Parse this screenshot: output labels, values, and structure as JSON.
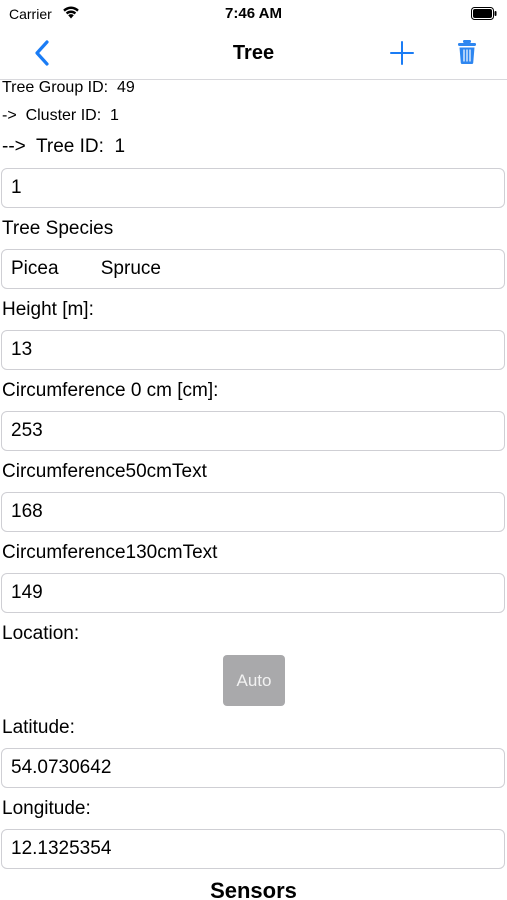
{
  "status_bar": {
    "carrier": "Carrier",
    "time": "7:46 AM"
  },
  "nav": {
    "title": "Tree",
    "accent": "#1a7cf5",
    "trash_color": "#2e86f0"
  },
  "meta": {
    "group_line": "Tree Group ID:  49",
    "cluster_line": "->  Cluster ID:  1",
    "tree_line": "-->  Tree ID:  1"
  },
  "fields": {
    "tree_id_value": "1",
    "species": {
      "label": "Tree Species",
      "value": "Picea        Spruce"
    },
    "height": {
      "label": "Height [m]:",
      "value": "13"
    },
    "circ0": {
      "label": "Circumference 0 cm [cm]:",
      "value": "253"
    },
    "circ50": {
      "label": "Circumference50cmText",
      "value": "168"
    },
    "circ130": {
      "label": "Circumference130cmText",
      "value": "149"
    },
    "location": {
      "label": "Location:",
      "auto_label": "Auto"
    },
    "latitude": {
      "label": "Latitude:",
      "value": "54.0730642"
    },
    "longitude": {
      "label": "Longitude:",
      "value": "12.1325354"
    }
  },
  "sensors": {
    "title": "Sensors"
  }
}
